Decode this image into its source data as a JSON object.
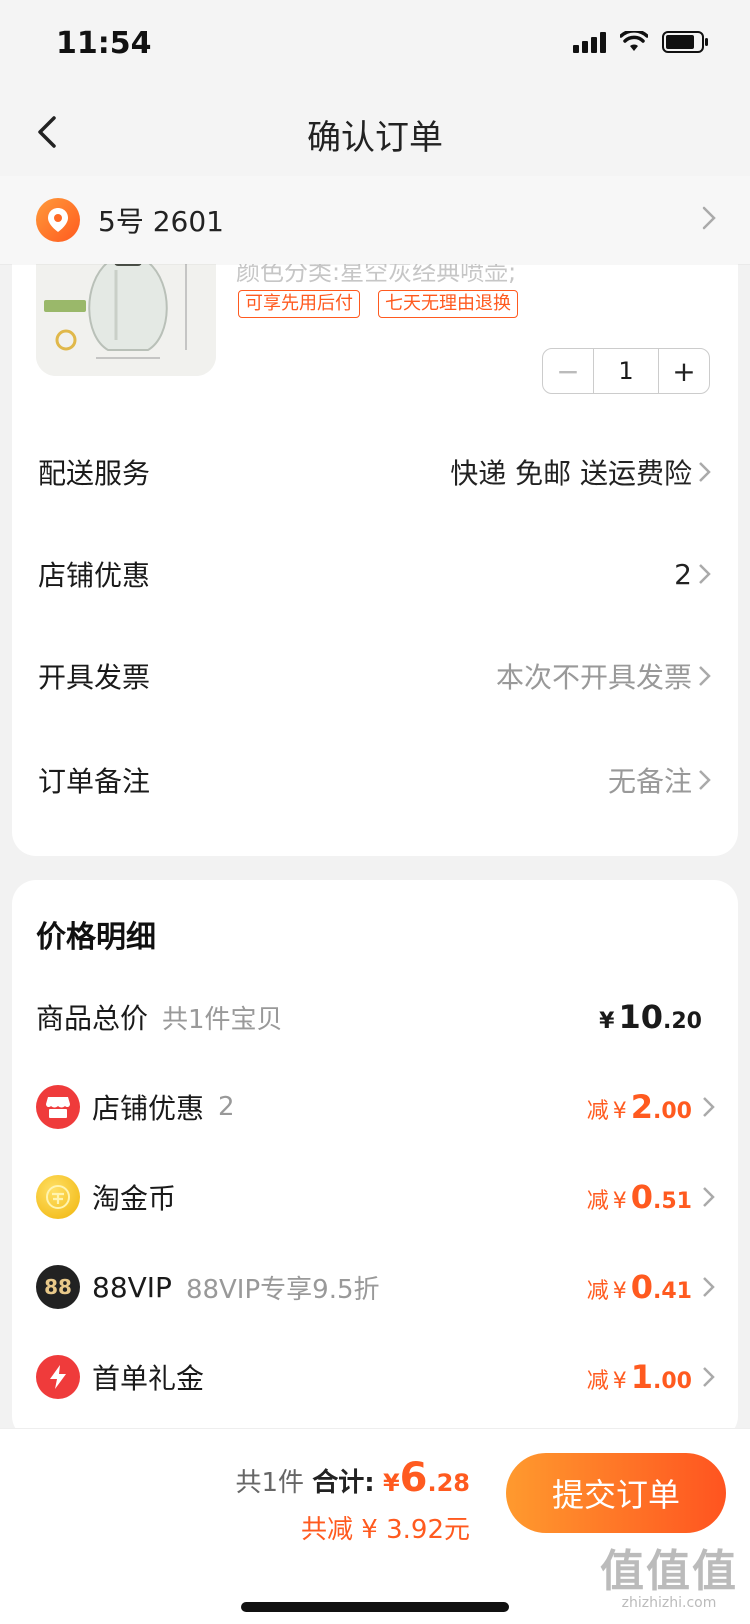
{
  "status": {
    "time": "11:54"
  },
  "nav": {
    "title": "确认订单"
  },
  "address": {
    "text": "5号 2601"
  },
  "product": {
    "variant": "颜色分类:星空灰经典喷壶;",
    "tags": [
      "可享先用后付",
      "七天无理由退换"
    ],
    "quantity": "1",
    "minus": "−",
    "plus": "+"
  },
  "options": [
    {
      "label": "配送服务",
      "value": "快递 免邮 送运费险"
    },
    {
      "label": "店铺优惠",
      "value": "2"
    },
    {
      "label": "开具发票",
      "value": "本次不开具发票"
    },
    {
      "label": "订单备注",
      "value": "无备注"
    }
  ],
  "price": {
    "title": "价格明细",
    "total": {
      "label": "商品总价",
      "sub": "共1件宝贝",
      "currency": "¥",
      "int": "10",
      "dec": ".20"
    },
    "discounts": [
      {
        "label": "店铺优惠",
        "sub": "2",
        "prefix": "减",
        "currency": "¥",
        "int": "2",
        "dec": ".00",
        "color": "#ef3b3b"
      },
      {
        "label": "淘金币",
        "sub": "",
        "prefix": "减",
        "currency": "¥",
        "int": "0",
        "dec": ".51",
        "color": "#f7c21c"
      },
      {
        "label": "88VIP",
        "sub": "88VIP专享9.5折",
        "prefix": "减",
        "currency": "¥",
        "int": "0",
        "dec": ".41",
        "color": "#222222"
      },
      {
        "label": "首单礼金",
        "sub": "",
        "prefix": "减",
        "currency": "¥",
        "int": "1",
        "dec": ".00",
        "color": "#ef3b3b"
      }
    ]
  },
  "footer": {
    "count": "共1件",
    "sum_label": "合计:",
    "currency": "¥",
    "sum_int": "6",
    "sum_dec": ".28",
    "saved": "共减 ¥ 3.92元",
    "submit": "提交订单"
  },
  "watermark": {
    "glyphs": "值值值",
    "site": "zhizhizhi.com"
  },
  "colors": {
    "accent": "#ff5a1f",
    "icon_vip": "88"
  }
}
